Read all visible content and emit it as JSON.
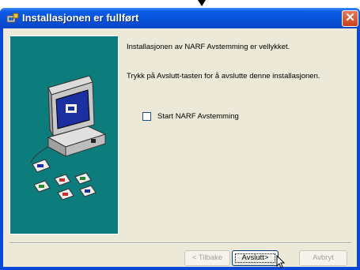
{
  "window": {
    "title": "Installasjonen er fullført",
    "close_glyph": "✕"
  },
  "content": {
    "success_message": "Installasjonen av NARF Avstemming er vellykket.",
    "instruction": "Trykk på Avslutt-tasten for å avslutte denne installasjonen.",
    "start_checkbox_label": "Start NARF Avstemming",
    "start_checkbox_checked": false
  },
  "buttons": {
    "back_label": "< Tilbake",
    "finish_label": "Avslutt>",
    "cancel_label": "Avbryt"
  },
  "icons": {
    "title": "installer-icon",
    "illustration": "computer-with-disks-icon",
    "pointer": "mouse-cursor-icon"
  }
}
